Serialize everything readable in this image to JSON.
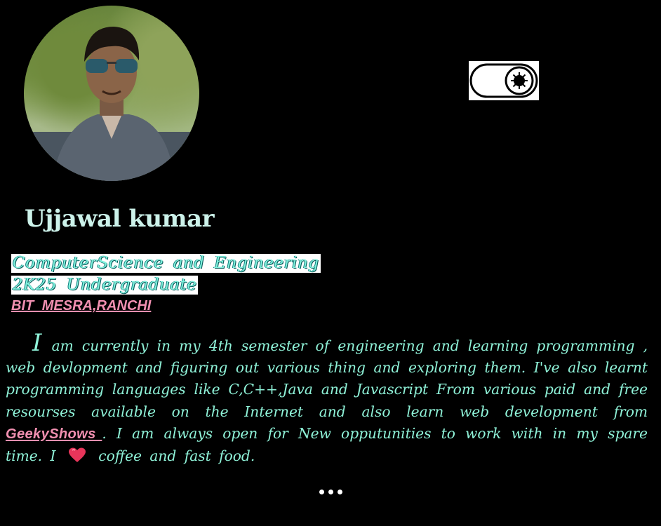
{
  "profile": {
    "name": "Ujjawal kumar",
    "department": "ComputerScience  and  Engineering",
    "batch": "2K25  Undergraduate",
    "college": "BIT MESRA,RANCHI"
  },
  "bio": {
    "drop_letter": "I",
    "part1": " am currently in my 4th semester of engineering and learning programming , web devlopment and figuring out various thing and exploring them. I've also learnt programming languages like C,C++,Java and Javascript From various paid and free resourses available on the Internet and also learn web development from ",
    "link": "GeekyShows ",
    "part2": ".    I am always open for New opputunities to work with in my spare time. I ",
    "heart_icon": "heart-icon",
    "part3": " coffee and fast food."
  },
  "theme_toggle": {
    "icon": "sun-icon",
    "state": "on"
  },
  "colors": {
    "accent": "#8ff2d8",
    "link": "#f08fb0",
    "background": "#000000"
  }
}
